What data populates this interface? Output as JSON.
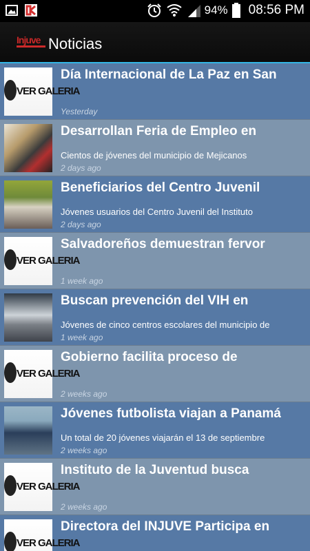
{
  "status_bar": {
    "battery": "94%",
    "time": "08:56 PM"
  },
  "action_bar": {
    "title": "Noticias",
    "logo_text": "Injuve"
  },
  "thumb_label": "VER GALERIA",
  "news": [
    {
      "title": "Día Internacional de La Paz en San",
      "summary": "",
      "time": "Yesterday",
      "thumb": "ver-galeria"
    },
    {
      "title": "Desarrollan Feria de Empleo en",
      "summary": "Cientos de jóvenes del municipio de Mejicanos",
      "time": "2 days ago",
      "thumb": "photo"
    },
    {
      "title": "Beneficiarios del Centro Juvenil",
      "summary": "Jóvenes usuarios del Centro Juvenil del Instituto",
      "time": "2 days ago",
      "thumb": "photo"
    },
    {
      "title": "Salvadoreños demuestran fervor",
      "summary": "",
      "time": "1 week ago",
      "thumb": "ver-galeria"
    },
    {
      "title": "Buscan prevención del VIH en",
      "summary": "Jóvenes de cinco centros escolares del municipio de",
      "time": "1 week ago",
      "thumb": "photo"
    },
    {
      "title": "Gobierno facilita proceso de",
      "summary": "",
      "time": "2 weeks ago",
      "thumb": "ver-galeria"
    },
    {
      "title": "Jóvenes futbolista viajan a Panamá",
      "summary": "Un total de 20 jóvenes viajarán el 13 de septiembre",
      "time": "2 weeks ago",
      "thumb": "photo"
    },
    {
      "title": "Instituto de la Juventud busca",
      "summary": "",
      "time": "2 weeks ago",
      "thumb": "ver-galeria"
    },
    {
      "title": "Directora del INJUVE Participa en",
      "summary": "",
      "time": "",
      "thumb": "ver-galeria"
    }
  ]
}
